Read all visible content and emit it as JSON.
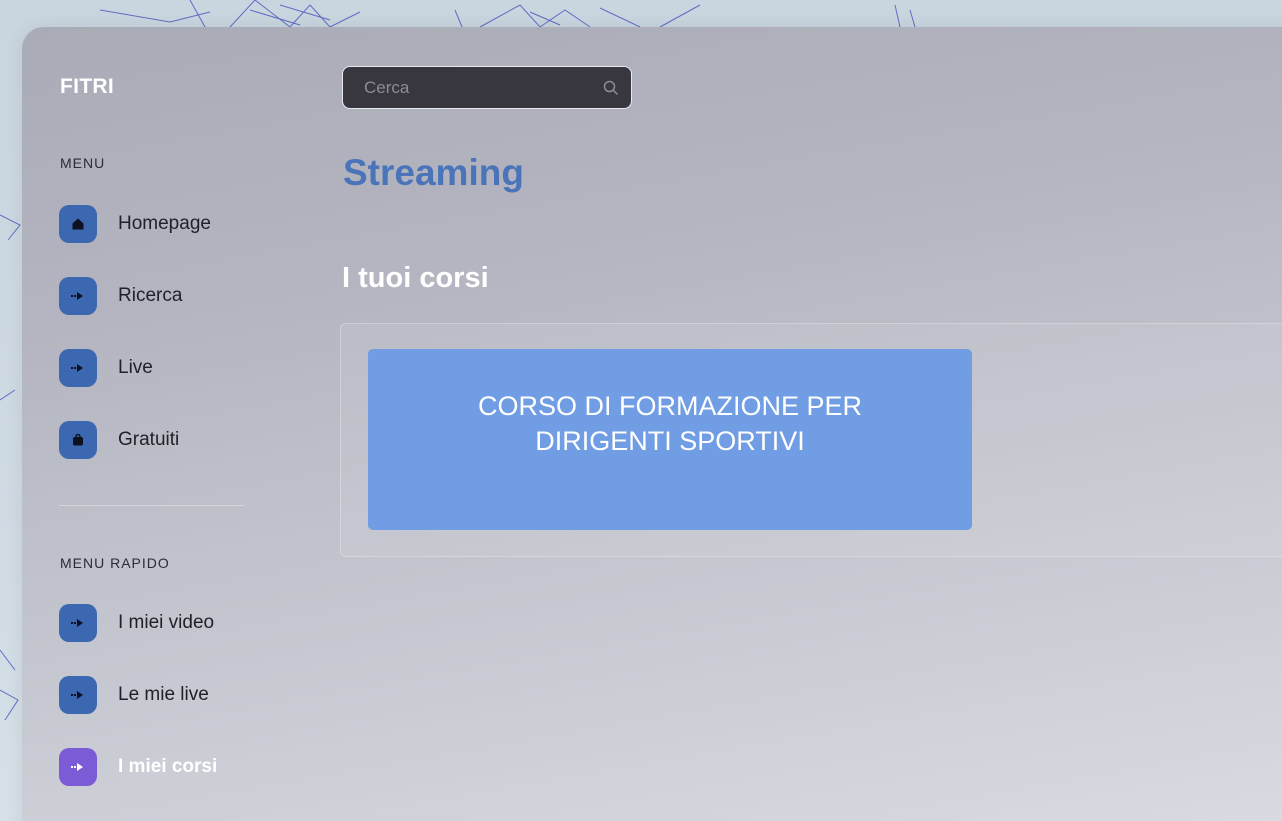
{
  "sidebar": {
    "brand": "FITRI",
    "menu_label": "MENU",
    "menu_items": [
      {
        "label": "Homepage",
        "icon": "home-icon"
      },
      {
        "label": "Ricerca",
        "icon": "arrow-right-icon"
      },
      {
        "label": "Live",
        "icon": "arrow-right-icon"
      },
      {
        "label": "Gratuiti",
        "icon": "bag-icon"
      }
    ],
    "quick_label": "MENU RAPIDO",
    "quick_items": [
      {
        "label": "I miei video",
        "icon": "arrow-right-icon"
      },
      {
        "label": "Le mie live",
        "icon": "arrow-right-icon"
      },
      {
        "label": "I miei corsi",
        "icon": "arrow-right-icon",
        "active": true
      }
    ]
  },
  "search": {
    "placeholder": "Cerca",
    "value": ""
  },
  "main": {
    "title": "Streaming",
    "section_title": "I tuoi corsi",
    "courses": [
      {
        "title": "CORSO DI FORMAZIONE PER DIRIGENTI SPORTIVI"
      }
    ]
  },
  "colors": {
    "accent": "#4a74b9",
    "nav_icon": "#3b68b0",
    "nav_icon_active": "#7b5cd6",
    "course_card": "#709de3",
    "search_bg": "#38363f"
  }
}
